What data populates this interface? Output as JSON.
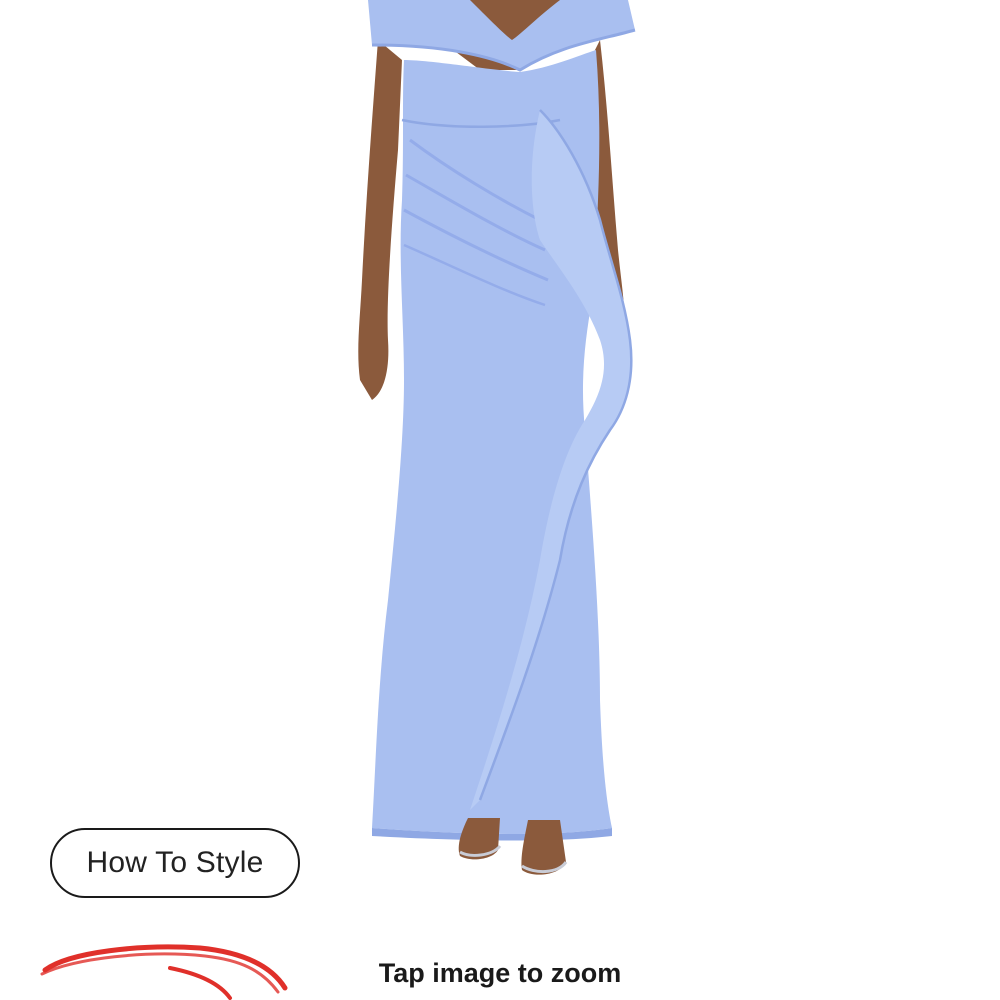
{
  "product": {
    "image_alt": "Light blue off-the-shoulder gown with ruffle",
    "dress_color": "#a9bff0",
    "dress_shadow_color": "#8fa8e4",
    "skin_color": "#8b5a3c"
  },
  "actions": {
    "how_to_style_label": "How To Style"
  },
  "hints": {
    "zoom_label": "Tap image to zoom"
  },
  "annotation": {
    "color": "#e0302a"
  }
}
